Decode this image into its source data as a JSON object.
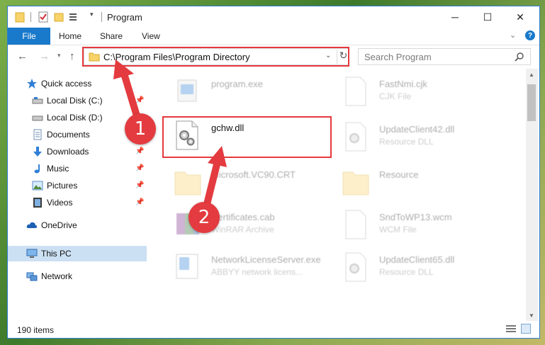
{
  "window": {
    "title": "Program",
    "controls": {
      "minimize": "─",
      "maximize": "☐",
      "close": "✕"
    }
  },
  "ribbon": {
    "tabs": [
      "File",
      "Home",
      "Share",
      "View"
    ],
    "help": "?"
  },
  "address": {
    "path": "C:\\Program Files\\Program Directory"
  },
  "search": {
    "placeholder": "Search Program"
  },
  "sidebar": {
    "items": [
      {
        "label": "Quick access",
        "icon": "star-icon",
        "pinned": false
      },
      {
        "label": "Local Disk (C:)",
        "icon": "drive-icon",
        "pinned": true
      },
      {
        "label": "Local Disk (D:)",
        "icon": "drive-icon",
        "pinned": false
      },
      {
        "label": "Documents",
        "icon": "documents-icon",
        "pinned": true
      },
      {
        "label": "Downloads",
        "icon": "download-icon",
        "pinned": true
      },
      {
        "label": "Music",
        "icon": "music-icon",
        "pinned": true
      },
      {
        "label": "Pictures",
        "icon": "pictures-icon",
        "pinned": true
      },
      {
        "label": "Videos",
        "icon": "videos-icon",
        "pinned": true
      },
      {
        "label": "OneDrive",
        "icon": "cloud-icon",
        "pinned": false
      },
      {
        "label": "This PC",
        "icon": "computer-icon",
        "pinned": false,
        "selected": true
      },
      {
        "label": "Network",
        "icon": "network-icon",
        "pinned": false
      }
    ]
  },
  "files": {
    "left": [
      {
        "name": "program.exe",
        "type": "",
        "icon": "exe-icon"
      },
      {
        "name": "gchw.dll",
        "type": "",
        "icon": "dll-gear-icon"
      },
      {
        "name": "Microsoft.VC90.CRT",
        "type": "",
        "icon": "folder-icon"
      },
      {
        "name": "Certificates.cab",
        "type": "WinRAR Archive",
        "icon": "archive-icon"
      },
      {
        "name": "NetworkLicenseServer.exe",
        "type": "ABBYY network licens...",
        "icon": "exe-icon"
      }
    ],
    "right": [
      {
        "name": "FastNmi.cjk",
        "type": "CJK File",
        "icon": "file-icon"
      },
      {
        "name": "UpdateClient42.dll",
        "type": "Resource DLL",
        "icon": "dll-gear-icon"
      },
      {
        "name": "Resource",
        "type": "",
        "icon": "folder-icon"
      },
      {
        "name": "SndToWP13.wcm",
        "type": "WCM File",
        "icon": "file-icon"
      },
      {
        "name": "UpdateClient65.dll",
        "type": "Resource DLL",
        "icon": "dll-gear-icon"
      }
    ]
  },
  "status": {
    "item_count": "190 items"
  },
  "annotations": {
    "step1": "1",
    "step2": "2",
    "color": "#e33b3f"
  }
}
